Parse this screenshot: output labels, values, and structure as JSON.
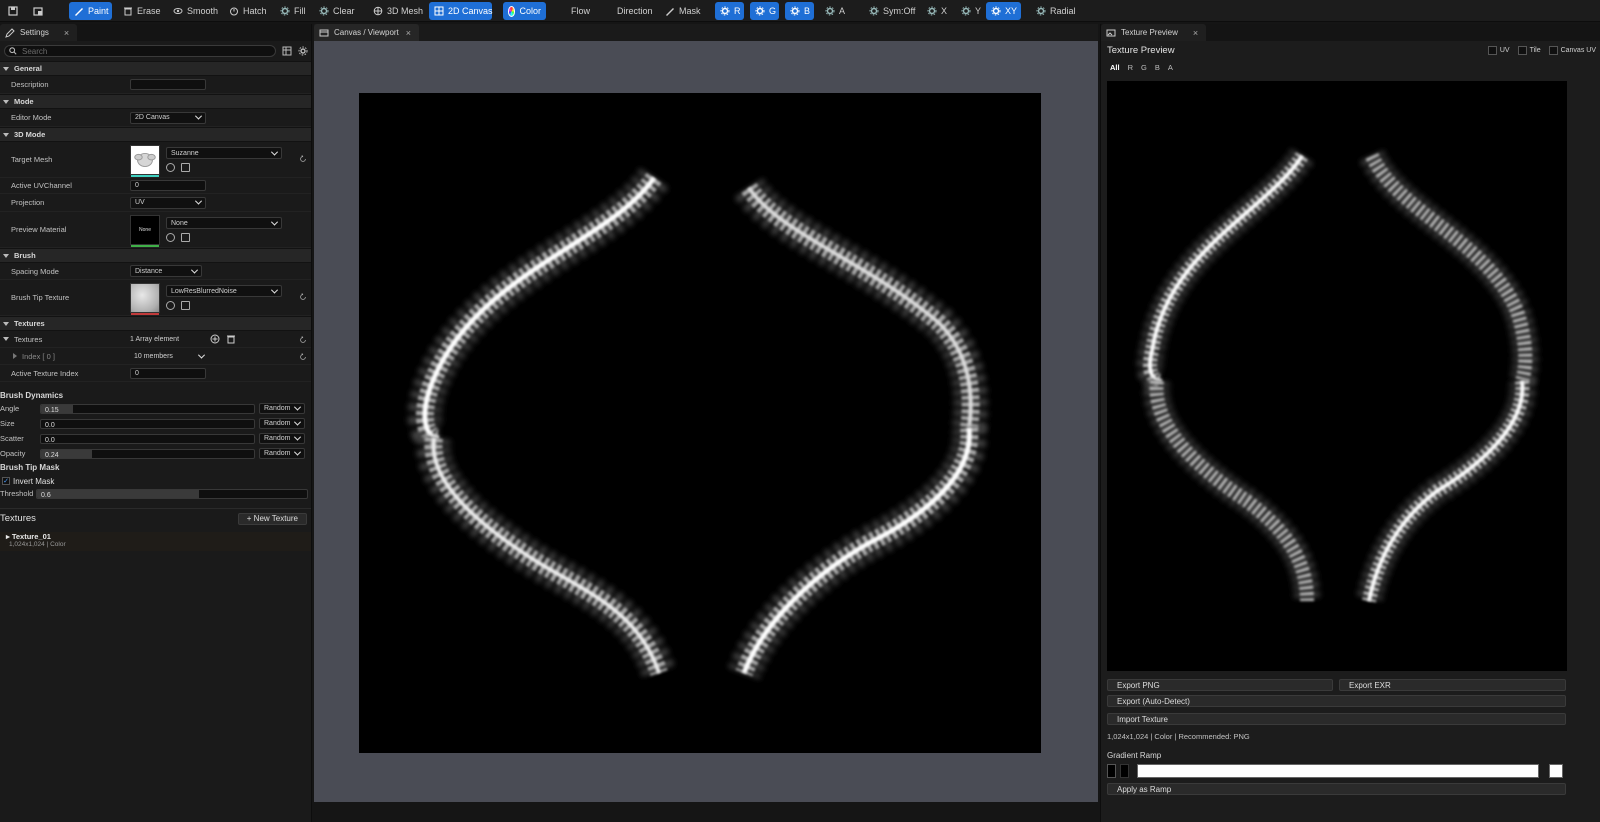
{
  "toolbar": {
    "paint": "Paint",
    "erase": "Erase",
    "smooth": "Smooth",
    "hatch": "Hatch",
    "fill": "Fill",
    "clear": "Clear",
    "mesh3d": "3D Mesh",
    "canvas2d": "2D Canvas",
    "color": "Color",
    "flow": "Flow",
    "direction": "Direction",
    "mask": "Mask",
    "r": "R",
    "g": "G",
    "b": "B",
    "a": "A",
    "sym": "Sym:Off",
    "x": "X",
    "y": "Y",
    "xy": "XY",
    "radial": "Radial",
    "accent": "#1f6fd6"
  },
  "settings": {
    "tab": "Settings",
    "search_placeholder": "Search",
    "general": "General",
    "description_label": "Description",
    "description_value": "",
    "mode": "Mode",
    "editor_mode_label": "Editor Mode",
    "editor_mode_value": "2D Canvas",
    "mode3d": "3D Mode",
    "target_mesh_label": "Target Mesh",
    "target_mesh_value": "Suzanne",
    "uv_channel_label": "Active UVChannel",
    "uv_channel_value": "0",
    "projection_label": "Projection",
    "projection_value": "UV",
    "preview_material_label": "Preview Material",
    "preview_material_value": "None",
    "preview_material_thumb": "None",
    "brush": "Brush",
    "spacing_label": "Spacing Mode",
    "spacing_value": "Distance",
    "tip_label": "Brush Tip Texture",
    "tip_value": "LowResBlurredNoise",
    "textures_section": "Textures",
    "textures_label": "Textures",
    "textures_value": "1 Array element",
    "index_label": "Index [ 0 ]",
    "index_value": "10 members",
    "active_index_label": "Active Texture Index",
    "active_index_value": "0"
  },
  "dynamics": {
    "title": "Brush Dynamics",
    "rows": [
      {
        "label": "Angle",
        "value": "0.15",
        "fraction": 0.15,
        "mode": "Random"
      },
      {
        "label": "Size",
        "value": "0.0",
        "fraction": 0.0,
        "mode": "Random"
      },
      {
        "label": "Scatter",
        "value": "0.0",
        "fraction": 0.0,
        "mode": "Random"
      },
      {
        "label": "Opacity",
        "value": "0.24",
        "fraction": 0.24,
        "mode": "Random"
      }
    ]
  },
  "tipmask": {
    "title": "Brush Tip Mask",
    "invert_label": "Invert Mask",
    "threshold_label": "Threshold",
    "threshold_value": "0.6",
    "threshold_fraction": 0.6
  },
  "texlist": {
    "title": "Textures",
    "new_button": "+ New Texture",
    "items": [
      {
        "name": "Texture_01",
        "meta": "1,024x1,024 | Color"
      }
    ]
  },
  "viewport": {
    "tab": "Canvas / Viewport"
  },
  "preview": {
    "tab": "Texture Preview",
    "title": "Texture Preview",
    "opt_uv": "UV",
    "opt_tile": "Tile",
    "opt_canvas_uv": "Canvas UV",
    "channels": [
      "All",
      "R",
      "G",
      "B",
      "A"
    ],
    "export_png": "Export PNG",
    "export_exr": "Export EXR",
    "export_auto": "Export (Auto-Detect)",
    "import": "Import Texture",
    "info": "1,024x1,024 | Color | Recommended: PNG",
    "ramp_label": "Gradient Ramp",
    "apply_ramp": "Apply as Ramp"
  }
}
